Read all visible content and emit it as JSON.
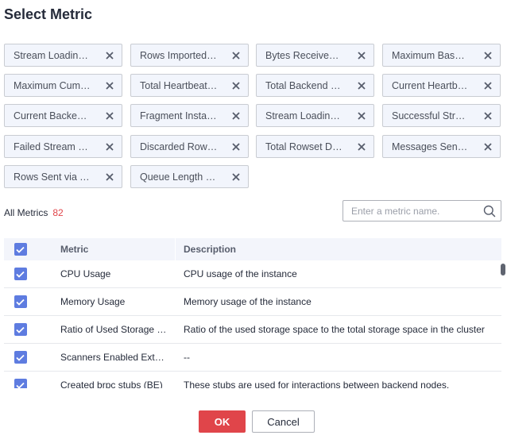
{
  "dialog": {
    "title": "Select Metric"
  },
  "selected_tags": [
    "Stream Loading Transactions",
    "Rows Imported via Stream Load",
    "Bytes Received via Stream Load",
    "Maximum Base Compaction Score",
    "Maximum Cumulative Compaction Score",
    "Total Heartbeat Requests",
    "Total Backend Sync Requests",
    "Current Heartbeat Requests",
    "Current Backend Sync Requests",
    "Fragment Instances Executed",
    "Stream Loading Requests",
    "Successful Stream Loads",
    "Failed Stream Loads",
    "Discarded Rows via Stream Load",
    "Total Rowset Data",
    "Messages Sent via Thrift",
    "Rows Sent via Thrift",
    "Queue Length of Tasks"
  ],
  "all_metrics": {
    "label": "All Metrics",
    "count": "82"
  },
  "search": {
    "placeholder": "Enter a metric name."
  },
  "table": {
    "headers": {
      "metric": "Metric",
      "description": "Description"
    },
    "rows": [
      {
        "metric": "CPU Usage",
        "description": "CPU usage of the instance"
      },
      {
        "metric": "Memory Usage",
        "description": "Memory usage of the instance"
      },
      {
        "metric": "Ratio of Used Storage Space",
        "description": "Ratio of the used storage space to the total storage space in the cluster"
      },
      {
        "metric": "Scanners Enabled Externally",
        "description": "--"
      },
      {
        "metric": "Created brpc stubs (BE)",
        "description": "These stubs are used for interactions between backend nodes."
      }
    ]
  },
  "buttons": {
    "ok": "OK",
    "cancel": "Cancel"
  },
  "colors": {
    "accent": "#5e7ce0",
    "danger": "#e0454a",
    "tag_bg": "#f2f5fc"
  }
}
